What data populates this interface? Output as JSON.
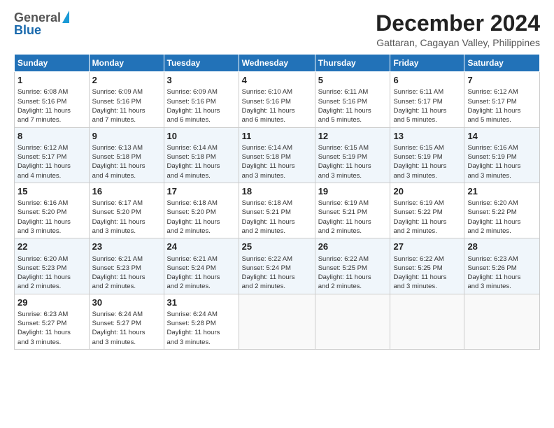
{
  "logo": {
    "general": "General",
    "blue": "Blue"
  },
  "header": {
    "title": "December 2024",
    "location": "Gattaran, Cagayan Valley, Philippines"
  },
  "days_of_week": [
    "Sunday",
    "Monday",
    "Tuesday",
    "Wednesday",
    "Thursday",
    "Friday",
    "Saturday"
  ],
  "weeks": [
    [
      {
        "day": "1",
        "lines": [
          "Sunrise: 6:08 AM",
          "Sunset: 5:16 PM",
          "Daylight: 11 hours",
          "and 7 minutes."
        ]
      },
      {
        "day": "2",
        "lines": [
          "Sunrise: 6:09 AM",
          "Sunset: 5:16 PM",
          "Daylight: 11 hours",
          "and 7 minutes."
        ]
      },
      {
        "day": "3",
        "lines": [
          "Sunrise: 6:09 AM",
          "Sunset: 5:16 PM",
          "Daylight: 11 hours",
          "and 6 minutes."
        ]
      },
      {
        "day": "4",
        "lines": [
          "Sunrise: 6:10 AM",
          "Sunset: 5:16 PM",
          "Daylight: 11 hours",
          "and 6 minutes."
        ]
      },
      {
        "day": "5",
        "lines": [
          "Sunrise: 6:11 AM",
          "Sunset: 5:16 PM",
          "Daylight: 11 hours",
          "and 5 minutes."
        ]
      },
      {
        "day": "6",
        "lines": [
          "Sunrise: 6:11 AM",
          "Sunset: 5:17 PM",
          "Daylight: 11 hours",
          "and 5 minutes."
        ]
      },
      {
        "day": "7",
        "lines": [
          "Sunrise: 6:12 AM",
          "Sunset: 5:17 PM",
          "Daylight: 11 hours",
          "and 5 minutes."
        ]
      }
    ],
    [
      {
        "day": "8",
        "lines": [
          "Sunrise: 6:12 AM",
          "Sunset: 5:17 PM",
          "Daylight: 11 hours",
          "and 4 minutes."
        ]
      },
      {
        "day": "9",
        "lines": [
          "Sunrise: 6:13 AM",
          "Sunset: 5:18 PM",
          "Daylight: 11 hours",
          "and 4 minutes."
        ]
      },
      {
        "day": "10",
        "lines": [
          "Sunrise: 6:14 AM",
          "Sunset: 5:18 PM",
          "Daylight: 11 hours",
          "and 4 minutes."
        ]
      },
      {
        "day": "11",
        "lines": [
          "Sunrise: 6:14 AM",
          "Sunset: 5:18 PM",
          "Daylight: 11 hours",
          "and 3 minutes."
        ]
      },
      {
        "day": "12",
        "lines": [
          "Sunrise: 6:15 AM",
          "Sunset: 5:19 PM",
          "Daylight: 11 hours",
          "and 3 minutes."
        ]
      },
      {
        "day": "13",
        "lines": [
          "Sunrise: 6:15 AM",
          "Sunset: 5:19 PM",
          "Daylight: 11 hours",
          "and 3 minutes."
        ]
      },
      {
        "day": "14",
        "lines": [
          "Sunrise: 6:16 AM",
          "Sunset: 5:19 PM",
          "Daylight: 11 hours",
          "and 3 minutes."
        ]
      }
    ],
    [
      {
        "day": "15",
        "lines": [
          "Sunrise: 6:16 AM",
          "Sunset: 5:20 PM",
          "Daylight: 11 hours",
          "and 3 minutes."
        ]
      },
      {
        "day": "16",
        "lines": [
          "Sunrise: 6:17 AM",
          "Sunset: 5:20 PM",
          "Daylight: 11 hours",
          "and 3 minutes."
        ]
      },
      {
        "day": "17",
        "lines": [
          "Sunrise: 6:18 AM",
          "Sunset: 5:20 PM",
          "Daylight: 11 hours",
          "and 2 minutes."
        ]
      },
      {
        "day": "18",
        "lines": [
          "Sunrise: 6:18 AM",
          "Sunset: 5:21 PM",
          "Daylight: 11 hours",
          "and 2 minutes."
        ]
      },
      {
        "day": "19",
        "lines": [
          "Sunrise: 6:19 AM",
          "Sunset: 5:21 PM",
          "Daylight: 11 hours",
          "and 2 minutes."
        ]
      },
      {
        "day": "20",
        "lines": [
          "Sunrise: 6:19 AM",
          "Sunset: 5:22 PM",
          "Daylight: 11 hours",
          "and 2 minutes."
        ]
      },
      {
        "day": "21",
        "lines": [
          "Sunrise: 6:20 AM",
          "Sunset: 5:22 PM",
          "Daylight: 11 hours",
          "and 2 minutes."
        ]
      }
    ],
    [
      {
        "day": "22",
        "lines": [
          "Sunrise: 6:20 AM",
          "Sunset: 5:23 PM",
          "Daylight: 11 hours",
          "and 2 minutes."
        ]
      },
      {
        "day": "23",
        "lines": [
          "Sunrise: 6:21 AM",
          "Sunset: 5:23 PM",
          "Daylight: 11 hours",
          "and 2 minutes."
        ]
      },
      {
        "day": "24",
        "lines": [
          "Sunrise: 6:21 AM",
          "Sunset: 5:24 PM",
          "Daylight: 11 hours",
          "and 2 minutes."
        ]
      },
      {
        "day": "25",
        "lines": [
          "Sunrise: 6:22 AM",
          "Sunset: 5:24 PM",
          "Daylight: 11 hours",
          "and 2 minutes."
        ]
      },
      {
        "day": "26",
        "lines": [
          "Sunrise: 6:22 AM",
          "Sunset: 5:25 PM",
          "Daylight: 11 hours",
          "and 2 minutes."
        ]
      },
      {
        "day": "27",
        "lines": [
          "Sunrise: 6:22 AM",
          "Sunset: 5:25 PM",
          "Daylight: 11 hours",
          "and 3 minutes."
        ]
      },
      {
        "day": "28",
        "lines": [
          "Sunrise: 6:23 AM",
          "Sunset: 5:26 PM",
          "Daylight: 11 hours",
          "and 3 minutes."
        ]
      }
    ],
    [
      {
        "day": "29",
        "lines": [
          "Sunrise: 6:23 AM",
          "Sunset: 5:27 PM",
          "Daylight: 11 hours",
          "and 3 minutes."
        ]
      },
      {
        "day": "30",
        "lines": [
          "Sunrise: 6:24 AM",
          "Sunset: 5:27 PM",
          "Daylight: 11 hours",
          "and 3 minutes."
        ]
      },
      {
        "day": "31",
        "lines": [
          "Sunrise: 6:24 AM",
          "Sunset: 5:28 PM",
          "Daylight: 11 hours",
          "and 3 minutes."
        ]
      },
      null,
      null,
      null,
      null
    ]
  ]
}
